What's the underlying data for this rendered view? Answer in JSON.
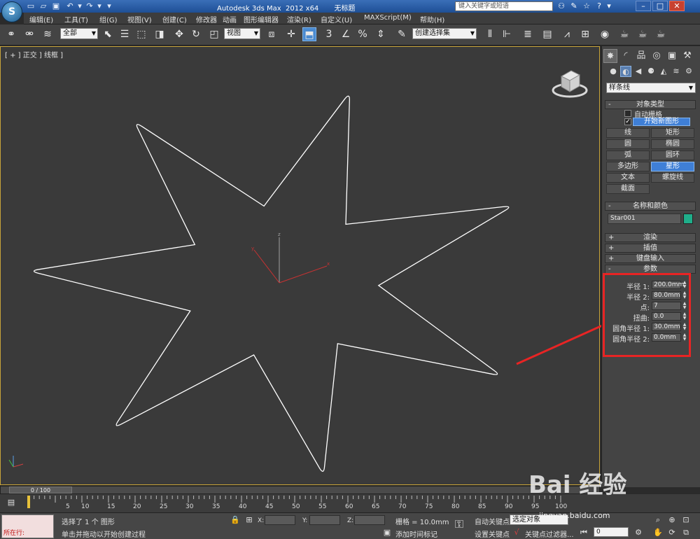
{
  "titlebar": {
    "title": "Autodesk 3ds Max  2012 x64       无标题",
    "search_placeholder": "键入关键字或短语",
    "app_logo": "S"
  },
  "menubar": {
    "items": [
      "编辑(E)",
      "工具(T)",
      "组(G)",
      "视图(V)",
      "创建(C)",
      "修改器",
      "动画",
      "图形编辑器",
      "渲染(R)",
      "自定义(U)",
      "MAXScript(M)",
      "帮助(H)"
    ]
  },
  "toolbar": {
    "selection_filter": "全部",
    "reference_coord": "视图",
    "named_selection": "创建选择集"
  },
  "viewport": {
    "label": "[ + ] 正交 ] 线框 ]",
    "star_color": "#ffffff",
    "axis_x_color": "#c83232",
    "axis_y_color": "#c83232",
    "axis_z_color": "#a0a0a0",
    "border_color": "#c8a43a"
  },
  "cmdpanel": {
    "category": "样条线",
    "object_type": {
      "header": "对象类型",
      "auto_grid_label": "自动栅格",
      "start_new_shape_label": "开始新图形",
      "buttons": [
        "线",
        "矩形",
        "圆",
        "椭圆",
        "弧",
        "圆环",
        "多边形",
        "星形",
        "文本",
        "螺旋线",
        "截面"
      ],
      "active_button": "星形"
    },
    "name_color": {
      "header": "名称和颜色",
      "name": "Star001",
      "color": "#1fae8a"
    },
    "rollouts": [
      "渲染",
      "插值",
      "键盘输入"
    ],
    "parameters": {
      "header": "参数",
      "fields": [
        {
          "label": "半径 1:",
          "value": "200.0mm"
        },
        {
          "label": "半径 2:",
          "value": "80.0mm"
        },
        {
          "label": "点:",
          "value": "7"
        },
        {
          "label": "扭曲:",
          "value": "0.0"
        },
        {
          "label": "圆角半径 1:",
          "value": "30.0mm"
        },
        {
          "label": "圆角半径 2:",
          "value": "0.0mm"
        }
      ]
    }
  },
  "annotation": {
    "highlight_color": "#e82424"
  },
  "timeline": {
    "slider": "0 / 100",
    "ticks": [
      "5",
      "10",
      "15",
      "20",
      "25",
      "30",
      "35",
      "40",
      "45",
      "50",
      "55",
      "60",
      "65",
      "70",
      "75",
      "80",
      "85",
      "90",
      "95",
      "100"
    ]
  },
  "statusbar": {
    "maxscript_label": "所在行:",
    "status_line1": "选择了 1 个 图形",
    "status_line2": "单击并拖动以开始创建过程",
    "x_label": "X:",
    "y_label": "Y:",
    "z_label": "Z:",
    "grid": "栅格 = 10.0mm",
    "add_time_tag": "添加时间标记",
    "auto_key": "自动关键点",
    "set_key": "设置关键点",
    "selection_set": "选定对象",
    "key_filters": "关键点过滤器...",
    "frame": "0"
  },
  "watermark": {
    "brand": "Bai 经验",
    "url": "jingyan.baidu.com"
  }
}
